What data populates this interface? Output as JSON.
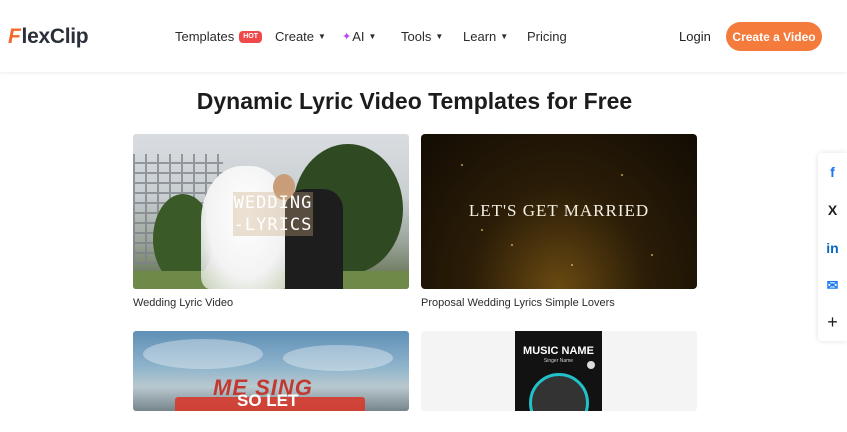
{
  "brand": {
    "logo_text": "lexClip",
    "logo_mark": "F"
  },
  "nav": {
    "templates": "Templates",
    "hot_badge": "HOT",
    "create": "Create",
    "ai": "AI",
    "tools": "Tools",
    "learn": "Learn",
    "pricing": "Pricing"
  },
  "header": {
    "login": "Login",
    "cta": "Create a Video"
  },
  "page": {
    "title": "Dynamic Lyric Video Templates for Free"
  },
  "cards": [
    {
      "caption": "Wedding Lyric Video",
      "overlay": "WEDDING -LYRICS"
    },
    {
      "caption": "Proposal Wedding Lyrics Simple Lovers",
      "overlay": "LET'S GET MARRIED"
    },
    {
      "caption": "",
      "overlay_top": "ME SING",
      "overlay_bottom": "SO LET"
    },
    {
      "caption": "",
      "overlay_title": "MUSIC NAME",
      "overlay_sub": "Singer Name"
    }
  ],
  "share": [
    {
      "icon": "facebook-icon",
      "glyph": "f",
      "color": "#1877f2"
    },
    {
      "icon": "x-icon",
      "glyph": "X",
      "color": "#1f1f1f"
    },
    {
      "icon": "linkedin-icon",
      "glyph": "in",
      "color": "#0a66c2"
    },
    {
      "icon": "email-icon",
      "glyph": "✉",
      "color": "#1877f2"
    },
    {
      "icon": "plus-icon",
      "glyph": "+",
      "color": "#1f1f1f"
    }
  ],
  "colors": {
    "accent": "#f47b3c",
    "hot": "#ef4a4a",
    "ai": "#b04cf2"
  }
}
